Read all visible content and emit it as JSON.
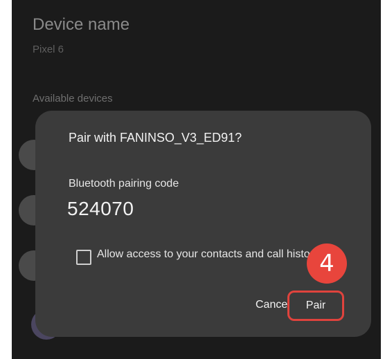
{
  "background": {
    "title": "Device name",
    "subtitle": "Pixel 6",
    "section": "Available devices"
  },
  "dialog": {
    "title": "Pair with FANINSO_V3_ED91?",
    "code_label": "Bluetooth pairing code",
    "code": "524070",
    "checkbox_label": "Allow access to your contacts and call history",
    "checkbox_checked": false,
    "cancel_label": "Cancel",
    "pair_label": "Pair"
  },
  "annotation": {
    "step": "4",
    "color": "#e8453c"
  }
}
